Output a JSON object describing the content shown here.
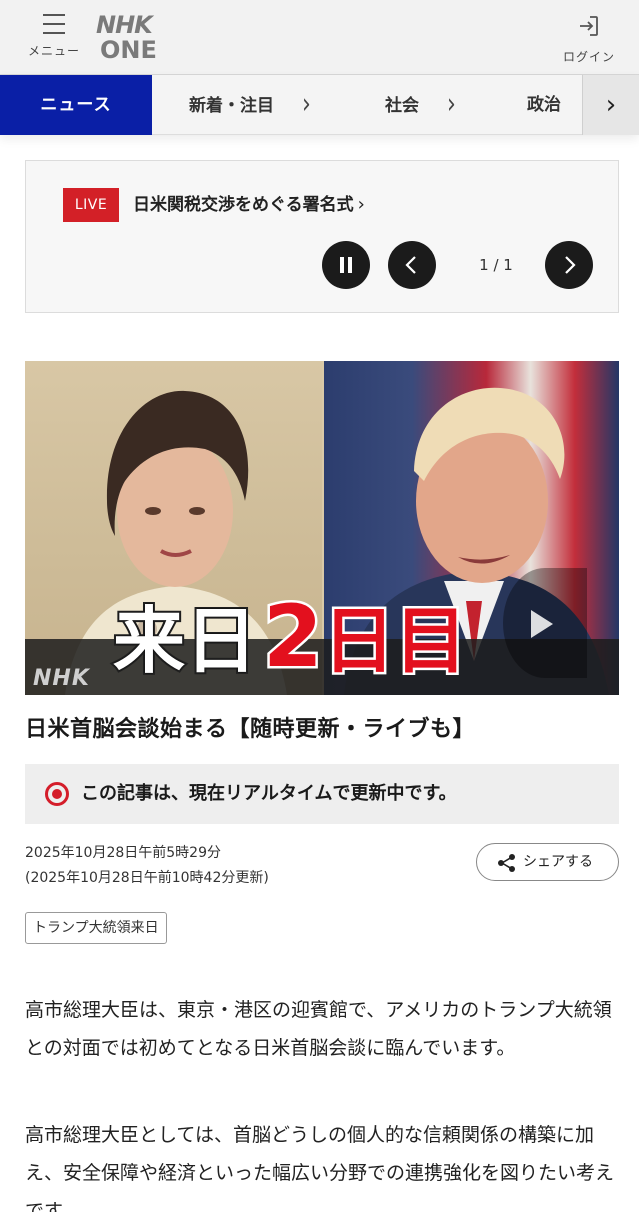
{
  "header": {
    "menu_label": "メニュー",
    "logo_line1": "NHK",
    "logo_line2": "ONE",
    "login_label": "ログイン"
  },
  "nav": {
    "active": "ニュース",
    "items": [
      {
        "label": "新着・注目"
      },
      {
        "label": "社会"
      },
      {
        "label": "政治"
      }
    ],
    "chevron": "›",
    "next": "›"
  },
  "live": {
    "badge": "LIVE",
    "title": "日米関税交渉をめぐる署名式",
    "chevron": "›",
    "counter": "1 / 1"
  },
  "hero": {
    "logo": "NHK",
    "caption_a": "来日",
    "caption_b": "2",
    "caption_c": "日目"
  },
  "article": {
    "headline": "日米首脳会談始まる【随時更新・ライブも】",
    "notice": "この記事は、現在リアルタイムで更新中です。",
    "published": "2025年10月28日午前5時29分",
    "updated": "(2025年10月28日午前10時42分更新)",
    "share_label": "シェアする",
    "tag": "トランプ大統領来日",
    "paragraphs": [
      "高市総理大臣は、東京・港区の迎賓館で、アメリカのトランプ大統領との対面では初めてとなる日米首脳会談に臨んでいます。",
      "高市総理大臣としては、首脳どうしの個人的な信頼関係の構築に加え、安全保障や経済といった幅広い分野での連携強化を図りたい考えです。"
    ]
  },
  "colors": {
    "accent_blue": "#0a1fa6",
    "live_red": "#d32027",
    "notice_red": "#d41d2a"
  }
}
